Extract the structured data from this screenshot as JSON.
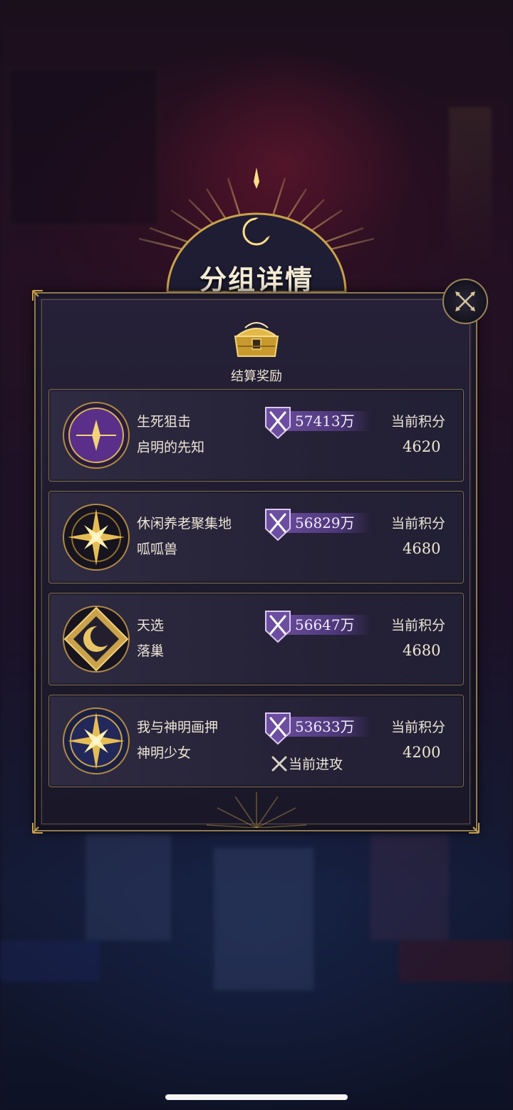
{
  "title": "分组详情",
  "reward": {
    "label": "结算奖励",
    "icon": "treasure-chest-icon"
  },
  "close_icon": "close-icon",
  "score_label": "当前积分",
  "attack_label": "当前进攻",
  "colors": {
    "gold": "#c9a24b",
    "panel": "#1d1a2c",
    "power_bar": "#5b3f8c"
  },
  "groups": [
    {
      "name": "生死狙击",
      "sub": "启明的先知",
      "power": "57413万",
      "score": "4620",
      "emblem": "crescent-emblem-purple"
    },
    {
      "name": "休闲养老聚集地",
      "sub": "呱呱兽",
      "power": "56829万",
      "score": "4680",
      "emblem": "compass-star-emblem-dark"
    },
    {
      "name": "天选",
      "sub": "落巢",
      "power": "56647万",
      "score": "4680",
      "emblem": "moon-diamond-emblem-gold"
    },
    {
      "name": "我与神明画押",
      "sub": "神明少女",
      "power": "53633万",
      "score": "4200",
      "emblem": "compass-star-emblem-blue",
      "attacking": true
    }
  ]
}
